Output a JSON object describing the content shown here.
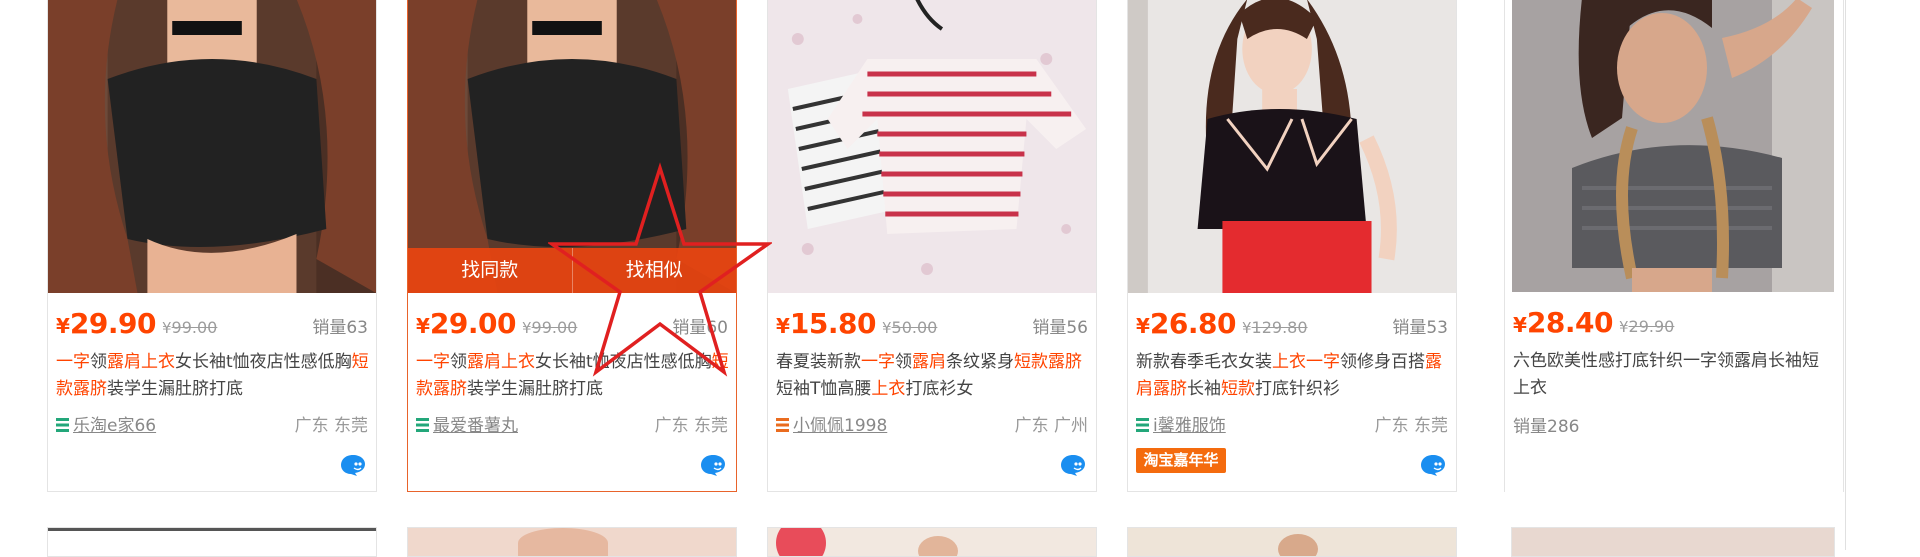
{
  "products": [
    {
      "yen": "¥",
      "price": "29.90",
      "orig_yen": "¥",
      "orig_price": "99.00",
      "sales": "销量63",
      "title_parts": [
        {
          "t": "一字",
          "h": true
        },
        {
          "t": "领",
          "h": false
        },
        {
          "t": "露肩上衣",
          "h": true
        },
        {
          "t": "女长袖t恤夜店性感低胸",
          "h": false
        },
        {
          "t": "短款露脐",
          "h": true
        },
        {
          "t": "装学生漏肚脐打底",
          "h": false
        }
      ],
      "shop": "乐淘e家66",
      "location": "广东 东莞"
    },
    {
      "yen": "¥",
      "price": "29.00",
      "orig_yen": "¥",
      "orig_price": "99.00",
      "sales": "销量60",
      "title_parts": [
        {
          "t": "一字",
          "h": true
        },
        {
          "t": "领",
          "h": false
        },
        {
          "t": "露肩上衣",
          "h": true
        },
        {
          "t": "女长袖t恤夜店性感低胸",
          "h": false
        },
        {
          "t": "短款露脐",
          "h": true
        },
        {
          "t": "装学生漏肚脐打底",
          "h": false
        }
      ],
      "shop": "最爱番薯丸",
      "location": "广东 东莞",
      "hover_actions": {
        "same": "找同款",
        "similar": "找相似"
      }
    },
    {
      "yen": "¥",
      "price": "15.80",
      "orig_yen": "¥",
      "orig_price": "50.00",
      "sales": "销量56",
      "title_parts": [
        {
          "t": "春夏装新款",
          "h": false
        },
        {
          "t": "一字",
          "h": true
        },
        {
          "t": "领",
          "h": false
        },
        {
          "t": "露肩",
          "h": true
        },
        {
          "t": "条纹紧身",
          "h": false
        },
        {
          "t": "短款露脐",
          "h": true
        },
        {
          "t": "短袖T恤高腰",
          "h": false
        },
        {
          "t": "上衣",
          "h": true
        },
        {
          "t": "打底衫女",
          "h": false
        }
      ],
      "shop": "小佩佩1998",
      "location": "广东 广州"
    },
    {
      "yen": "¥",
      "price": "26.80",
      "orig_yen": "¥",
      "orig_price": "129.80",
      "sales": "销量53",
      "title_parts": [
        {
          "t": "新款春季毛衣女装",
          "h": false
        },
        {
          "t": "上衣一字",
          "h": true
        },
        {
          "t": "领修身百搭",
          "h": false
        },
        {
          "t": "露肩露脐",
          "h": true
        },
        {
          "t": "长袖",
          "h": false
        },
        {
          "t": "短款",
          "h": true
        },
        {
          "t": "打底针织衫",
          "h": false
        }
      ],
      "shop": "i馨雅服饰",
      "location": "广东 东莞",
      "badge": "淘宝嘉年华"
    },
    {
      "yen": "¥",
      "price": "28.40",
      "orig_yen": "¥",
      "orig_price": "29.90",
      "title_parts": [
        {
          "t": "六色欧美性感打底针织一字领露肩长袖短上衣",
          "h": false
        }
      ],
      "sales_only": "销量286"
    }
  ],
  "colors": {
    "price": "#ff4400",
    "accent_border": "#e8632b",
    "hover_bar": "#e84410"
  }
}
